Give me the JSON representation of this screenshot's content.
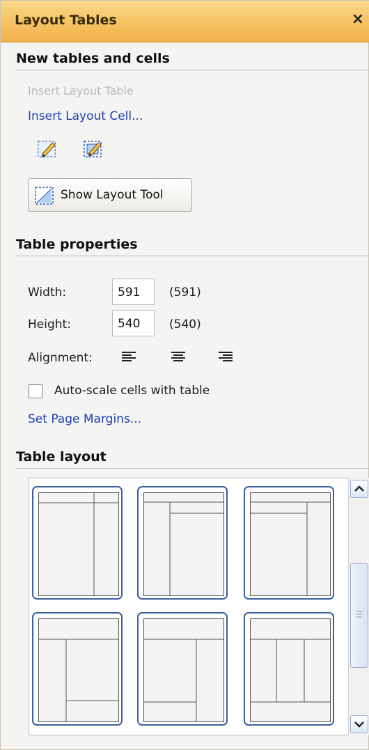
{
  "window": {
    "title": "Layout Tables",
    "close_glyph": "×"
  },
  "new_tables": {
    "header": "New tables and cells",
    "insert_layout_table": "Insert Layout Table",
    "insert_layout_cell": "Insert Layout Cell...",
    "draw_table_icon": "draw-layout-table-icon",
    "draw_cell_icon": "draw-layout-cell-icon",
    "show_layout_tool_label": "Show Layout Tool"
  },
  "table_properties": {
    "header": "Table properties",
    "width_label": "Width:",
    "width_value": "591",
    "width_actual": "(591)",
    "height_label": "Height:",
    "height_value": "540",
    "height_actual": "(540)",
    "alignment_label": "Alignment:",
    "alignment_icons": [
      "align-left-icon",
      "align-center-icon",
      "align-right-icon"
    ],
    "autoscale_label": "Auto-scale cells with table",
    "autoscale_checked": false,
    "set_margins_link": "Set Page Margins..."
  },
  "table_layout": {
    "header": "Table layout",
    "thumbnail_count": 6
  },
  "colors": {
    "titlebar": "#f6c66a",
    "link": "#1d3db3",
    "thumb_border": "#3b5f9e"
  }
}
